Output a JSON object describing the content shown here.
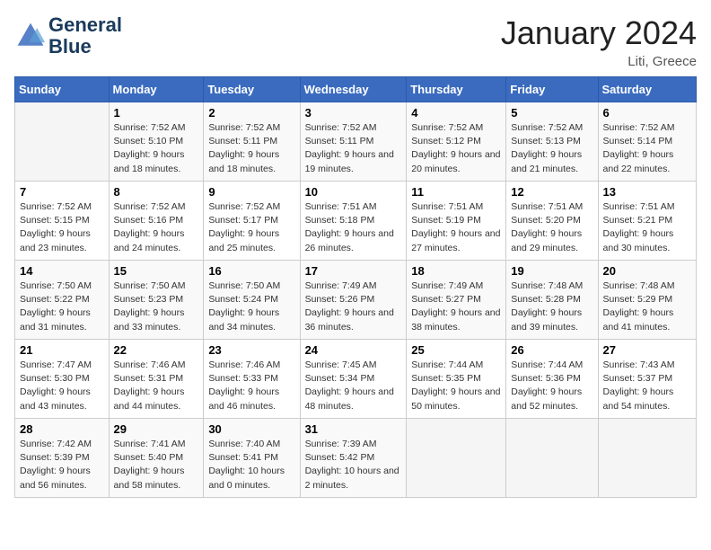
{
  "header": {
    "logo_line1": "General",
    "logo_line2": "Blue",
    "month_title": "January 2024",
    "location": "Liti, Greece"
  },
  "weekdays": [
    "Sunday",
    "Monday",
    "Tuesday",
    "Wednesday",
    "Thursday",
    "Friday",
    "Saturday"
  ],
  "weeks": [
    [
      {
        "day": "",
        "sunrise": "",
        "sunset": "",
        "daylight": ""
      },
      {
        "day": "1",
        "sunrise": "Sunrise: 7:52 AM",
        "sunset": "Sunset: 5:10 PM",
        "daylight": "Daylight: 9 hours and 18 minutes."
      },
      {
        "day": "2",
        "sunrise": "Sunrise: 7:52 AM",
        "sunset": "Sunset: 5:11 PM",
        "daylight": "Daylight: 9 hours and 18 minutes."
      },
      {
        "day": "3",
        "sunrise": "Sunrise: 7:52 AM",
        "sunset": "Sunset: 5:11 PM",
        "daylight": "Daylight: 9 hours and 19 minutes."
      },
      {
        "day": "4",
        "sunrise": "Sunrise: 7:52 AM",
        "sunset": "Sunset: 5:12 PM",
        "daylight": "Daylight: 9 hours and 20 minutes."
      },
      {
        "day": "5",
        "sunrise": "Sunrise: 7:52 AM",
        "sunset": "Sunset: 5:13 PM",
        "daylight": "Daylight: 9 hours and 21 minutes."
      },
      {
        "day": "6",
        "sunrise": "Sunrise: 7:52 AM",
        "sunset": "Sunset: 5:14 PM",
        "daylight": "Daylight: 9 hours and 22 minutes."
      }
    ],
    [
      {
        "day": "7",
        "sunrise": "Sunrise: 7:52 AM",
        "sunset": "Sunset: 5:15 PM",
        "daylight": "Daylight: 9 hours and 23 minutes."
      },
      {
        "day": "8",
        "sunrise": "Sunrise: 7:52 AM",
        "sunset": "Sunset: 5:16 PM",
        "daylight": "Daylight: 9 hours and 24 minutes."
      },
      {
        "day": "9",
        "sunrise": "Sunrise: 7:52 AM",
        "sunset": "Sunset: 5:17 PM",
        "daylight": "Daylight: 9 hours and 25 minutes."
      },
      {
        "day": "10",
        "sunrise": "Sunrise: 7:51 AM",
        "sunset": "Sunset: 5:18 PM",
        "daylight": "Daylight: 9 hours and 26 minutes."
      },
      {
        "day": "11",
        "sunrise": "Sunrise: 7:51 AM",
        "sunset": "Sunset: 5:19 PM",
        "daylight": "Daylight: 9 hours and 27 minutes."
      },
      {
        "day": "12",
        "sunrise": "Sunrise: 7:51 AM",
        "sunset": "Sunset: 5:20 PM",
        "daylight": "Daylight: 9 hours and 29 minutes."
      },
      {
        "day": "13",
        "sunrise": "Sunrise: 7:51 AM",
        "sunset": "Sunset: 5:21 PM",
        "daylight": "Daylight: 9 hours and 30 minutes."
      }
    ],
    [
      {
        "day": "14",
        "sunrise": "Sunrise: 7:50 AM",
        "sunset": "Sunset: 5:22 PM",
        "daylight": "Daylight: 9 hours and 31 minutes."
      },
      {
        "day": "15",
        "sunrise": "Sunrise: 7:50 AM",
        "sunset": "Sunset: 5:23 PM",
        "daylight": "Daylight: 9 hours and 33 minutes."
      },
      {
        "day": "16",
        "sunrise": "Sunrise: 7:50 AM",
        "sunset": "Sunset: 5:24 PM",
        "daylight": "Daylight: 9 hours and 34 minutes."
      },
      {
        "day": "17",
        "sunrise": "Sunrise: 7:49 AM",
        "sunset": "Sunset: 5:26 PM",
        "daylight": "Daylight: 9 hours and 36 minutes."
      },
      {
        "day": "18",
        "sunrise": "Sunrise: 7:49 AM",
        "sunset": "Sunset: 5:27 PM",
        "daylight": "Daylight: 9 hours and 38 minutes."
      },
      {
        "day": "19",
        "sunrise": "Sunrise: 7:48 AM",
        "sunset": "Sunset: 5:28 PM",
        "daylight": "Daylight: 9 hours and 39 minutes."
      },
      {
        "day": "20",
        "sunrise": "Sunrise: 7:48 AM",
        "sunset": "Sunset: 5:29 PM",
        "daylight": "Daylight: 9 hours and 41 minutes."
      }
    ],
    [
      {
        "day": "21",
        "sunrise": "Sunrise: 7:47 AM",
        "sunset": "Sunset: 5:30 PM",
        "daylight": "Daylight: 9 hours and 43 minutes."
      },
      {
        "day": "22",
        "sunrise": "Sunrise: 7:46 AM",
        "sunset": "Sunset: 5:31 PM",
        "daylight": "Daylight: 9 hours and 44 minutes."
      },
      {
        "day": "23",
        "sunrise": "Sunrise: 7:46 AM",
        "sunset": "Sunset: 5:33 PM",
        "daylight": "Daylight: 9 hours and 46 minutes."
      },
      {
        "day": "24",
        "sunrise": "Sunrise: 7:45 AM",
        "sunset": "Sunset: 5:34 PM",
        "daylight": "Daylight: 9 hours and 48 minutes."
      },
      {
        "day": "25",
        "sunrise": "Sunrise: 7:44 AM",
        "sunset": "Sunset: 5:35 PM",
        "daylight": "Daylight: 9 hours and 50 minutes."
      },
      {
        "day": "26",
        "sunrise": "Sunrise: 7:44 AM",
        "sunset": "Sunset: 5:36 PM",
        "daylight": "Daylight: 9 hours and 52 minutes."
      },
      {
        "day": "27",
        "sunrise": "Sunrise: 7:43 AM",
        "sunset": "Sunset: 5:37 PM",
        "daylight": "Daylight: 9 hours and 54 minutes."
      }
    ],
    [
      {
        "day": "28",
        "sunrise": "Sunrise: 7:42 AM",
        "sunset": "Sunset: 5:39 PM",
        "daylight": "Daylight: 9 hours and 56 minutes."
      },
      {
        "day": "29",
        "sunrise": "Sunrise: 7:41 AM",
        "sunset": "Sunset: 5:40 PM",
        "daylight": "Daylight: 9 hours and 58 minutes."
      },
      {
        "day": "30",
        "sunrise": "Sunrise: 7:40 AM",
        "sunset": "Sunset: 5:41 PM",
        "daylight": "Daylight: 10 hours and 0 minutes."
      },
      {
        "day": "31",
        "sunrise": "Sunrise: 7:39 AM",
        "sunset": "Sunset: 5:42 PM",
        "daylight": "Daylight: 10 hours and 2 minutes."
      },
      {
        "day": "",
        "sunrise": "",
        "sunset": "",
        "daylight": ""
      },
      {
        "day": "",
        "sunrise": "",
        "sunset": "",
        "daylight": ""
      },
      {
        "day": "",
        "sunrise": "",
        "sunset": "",
        "daylight": ""
      }
    ]
  ]
}
